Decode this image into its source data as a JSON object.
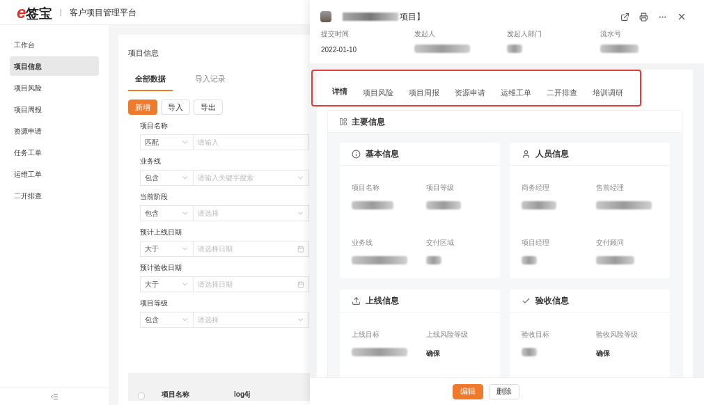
{
  "header": {
    "logo_mark": "e",
    "logo_text": "签宝",
    "platform_title": "客户项目管理平台"
  },
  "sidebar": {
    "items": [
      {
        "label": "工作台",
        "selected": false
      },
      {
        "label": "项目信息",
        "selected": true
      },
      {
        "label": "项目风险",
        "selected": false
      },
      {
        "label": "项目周报",
        "selected": false
      },
      {
        "label": "资源申请",
        "selected": false
      },
      {
        "label": "任务工单",
        "selected": false
      },
      {
        "label": "运维工单",
        "selected": false
      },
      {
        "label": "二开排查",
        "selected": false
      }
    ]
  },
  "page": {
    "title": "项目信息",
    "tabs": [
      {
        "label": "全部数据",
        "selected": true
      },
      {
        "label": "导入记录",
        "selected": false
      }
    ],
    "buttons": [
      {
        "label": "新增",
        "kind": "primary"
      },
      {
        "label": "导入",
        "kind": "default"
      },
      {
        "label": "导出",
        "kind": "default"
      }
    ],
    "filters": [
      {
        "label": "项目名称",
        "operator": "匹配",
        "placeholder": "请输入",
        "kind": "text"
      },
      {
        "label": "业务线",
        "operator": "包含",
        "placeholder": "请输入关键字搜索",
        "kind": "select"
      },
      {
        "label": "当前阶段",
        "operator": "包含",
        "placeholder": "请选择",
        "kind": "select"
      },
      {
        "label": "预计上线日期",
        "operator": "大于",
        "placeholder": "请选择日期",
        "kind": "date"
      },
      {
        "label": "预计验收日期",
        "operator": "大于",
        "placeholder": "请选择日期",
        "kind": "date"
      },
      {
        "label": "项目等级",
        "operator": "包含",
        "placeholder": "请选择",
        "kind": "select"
      }
    ],
    "table": {
      "checked": false,
      "columns": [
        "项目名称",
        "log4j"
      ]
    }
  },
  "drawer": {
    "title_end": "项目】",
    "meta": [
      {
        "label": "提交时间",
        "value": "2022-01-10",
        "blurred": false
      },
      {
        "label": "发起人",
        "blurred": true
      },
      {
        "label": "发起人部门",
        "blurred": true
      },
      {
        "label": "流水号",
        "blurred": true
      }
    ],
    "tabs": [
      {
        "label": "详情",
        "selected": true
      },
      {
        "label": "项目风险",
        "selected": false
      },
      {
        "label": "项目周报",
        "selected": false
      },
      {
        "label": "资源申请",
        "selected": false
      },
      {
        "label": "运维工单",
        "selected": false
      },
      {
        "label": "二开排查",
        "selected": false
      },
      {
        "label": "培训调研",
        "selected": false
      }
    ],
    "section_title": "主要信息",
    "cards": [
      {
        "title": "基本信息",
        "kind": "info",
        "fields": [
          {
            "label": "项目名称",
            "blurred": true
          },
          {
            "label": "项目等级",
            "blurred": true
          },
          {
            "label": "业务线",
            "blurred": true
          },
          {
            "label": "交付区域",
            "blurred": true
          }
        ]
      },
      {
        "title": "人员信息",
        "kind": "user",
        "fields": [
          {
            "label": "商务经理",
            "blurred": true
          },
          {
            "label": "售前经理",
            "blurred": true
          },
          {
            "label": "项目经理",
            "blurred": true
          },
          {
            "label": "交付顾问",
            "blurred": true
          }
        ]
      },
      {
        "title": "上线信息",
        "kind": "upload",
        "fields": [
          {
            "label": "上线目标",
            "blurred": true
          },
          {
            "label": "上线风险等级",
            "value": "确保",
            "blurred": false
          }
        ]
      },
      {
        "title": "验收信息",
        "kind": "check",
        "fields": [
          {
            "label": "验收目标",
            "blurred": true
          },
          {
            "label": "验收风险等级",
            "value": "确保",
            "blurred": false
          }
        ]
      }
    ],
    "footer_buttons": [
      {
        "label": "编辑",
        "kind": "primary"
      },
      {
        "label": "删除",
        "kind": "default"
      }
    ]
  }
}
